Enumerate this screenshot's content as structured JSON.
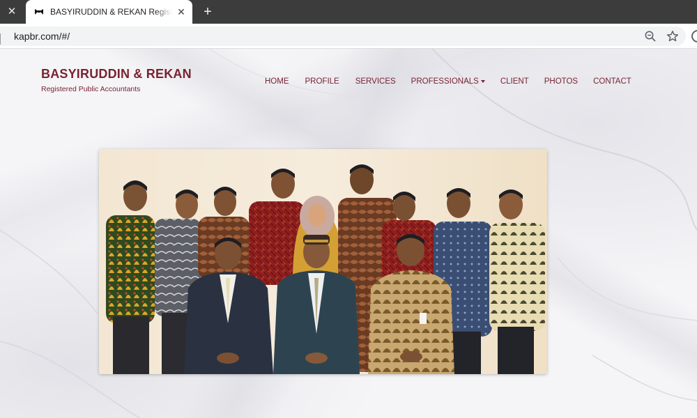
{
  "browser": {
    "tab": {
      "title": "BASYIRUDDIN & REKAN Registered Public Accountants"
    },
    "url": "kapbr.com/#/",
    "icons": [
      "close-icon",
      "favicon-icon",
      "plus-icon",
      "zoom-icon",
      "star-icon",
      "profile-icon"
    ]
  },
  "site": {
    "brand": {
      "title": "BASYIRUDDIN & REKAN",
      "subtitle": "Registered Public Accountants"
    },
    "nav": [
      {
        "label": "HOME"
      },
      {
        "label": "PROFILE"
      },
      {
        "label": "SERVICES"
      },
      {
        "label": "PROFESSIONALS",
        "dropdown": true
      },
      {
        "label": "CLIENT"
      },
      {
        "label": "PHOTOS"
      },
      {
        "label": "CONTACT"
      }
    ],
    "hero": {
      "people_count": 12
    }
  },
  "colors": {
    "brand": "#7a2231",
    "chrome_dark": "#3c3c3c",
    "omnibox": "#f1f3f4"
  }
}
